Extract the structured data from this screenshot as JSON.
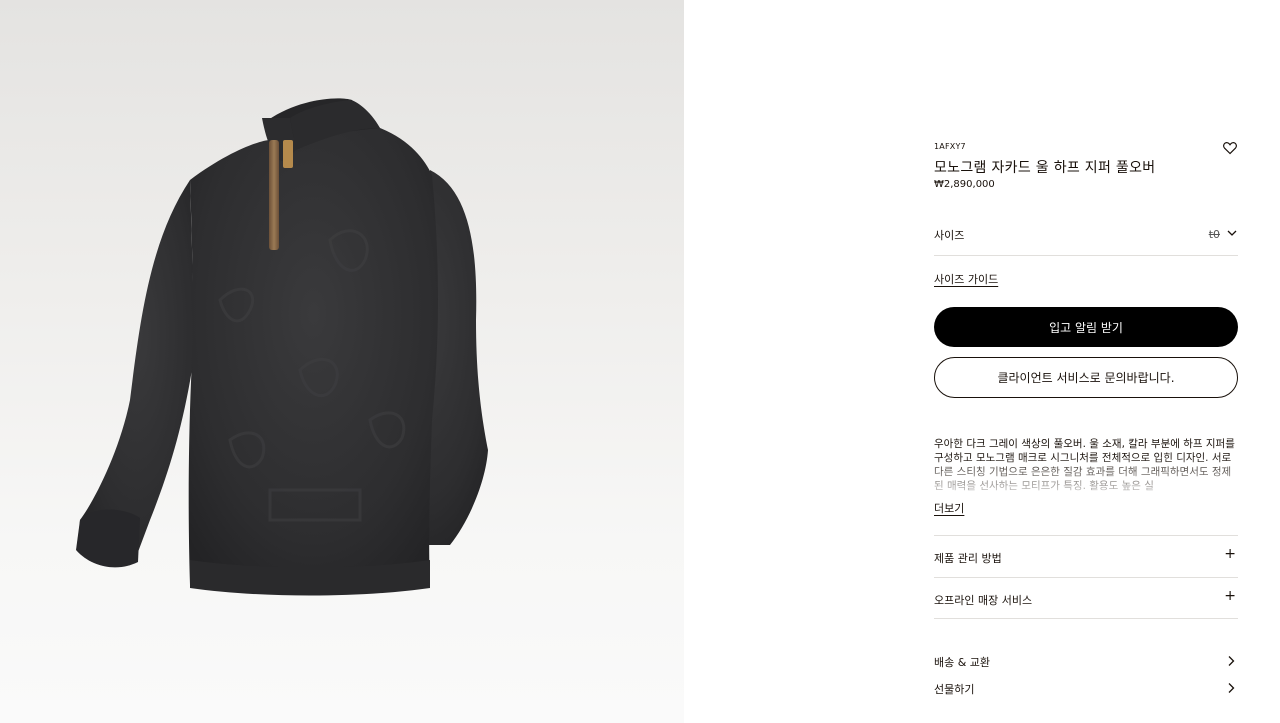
{
  "product": {
    "sku": "1AFXY7",
    "name": "모노그램 자카드 울 하프 지퍼 풀오버",
    "price": "₩2,890,000",
    "image_alt": "다크 그레이 하프 지퍼 풀오버"
  },
  "size": {
    "label": "사이즈",
    "selected": "t0",
    "guide_label": "사이즈 가이드"
  },
  "actions": {
    "notify_label": "입고 알림 받기",
    "contact_label": "클라이언트 서비스로 문의바랍니다."
  },
  "description": {
    "text": "우아한 다크 그레이 색상의 풀오버. 울 소재, 칼라 부분에 하프 지퍼를 구성하고 모노그램 매크로 시그니처를 전체적으로 입힌 디자인. 서로 다른 스티칭 기법으로 은은한 질감 효과를 더해 그래픽하면서도 정제된 매력을 선사하는 모티프가 특징. 활용도 높은 실",
    "read_more": "더보기"
  },
  "accordions": [
    {
      "label": "제품 관리 방법",
      "icon": "plus-icon"
    },
    {
      "label": "오프라인 매장 서비스",
      "icon": "plus-icon"
    }
  ],
  "links": [
    {
      "label": "배송 & 교환",
      "icon": "chevron-right-icon"
    },
    {
      "label": "선물하기",
      "icon": "chevron-right-icon"
    }
  ],
  "colors": {
    "text": "#19110b",
    "primary_button": "#000000",
    "divider": "#e1dfdc",
    "image_background": "#ebeae8",
    "sweater": "#2f2f31"
  }
}
